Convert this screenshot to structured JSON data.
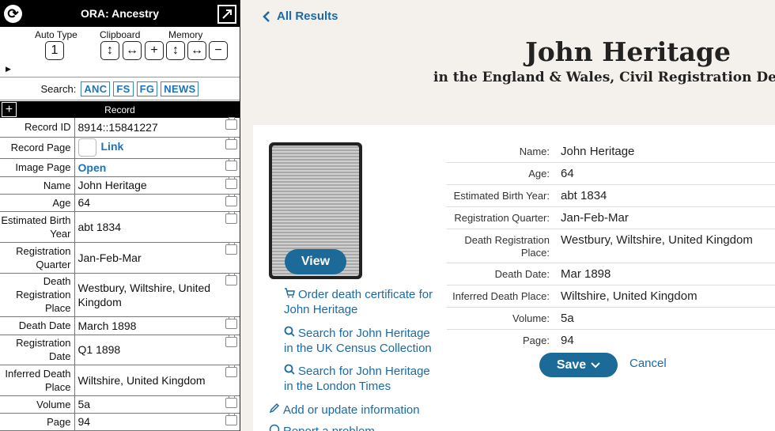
{
  "ora": {
    "title": "ORA: Ancestry",
    "controls": {
      "auto_type_label": "Auto Type",
      "auto_type_value": "1",
      "clipboard_label": "Clipboard",
      "memory_label": "Memory"
    },
    "search": {
      "label": "Search:",
      "sources": [
        "ANC",
        "FS",
        "FG",
        "NEWS"
      ]
    },
    "record_header": "Record",
    "fields": [
      {
        "key": "Record ID",
        "value": "8914::15841227"
      },
      {
        "key": "Record Page",
        "value": "Link"
      },
      {
        "key": "Image Page",
        "value": "Open"
      },
      {
        "key": "Name",
        "value": "John Heritage"
      },
      {
        "key": "Age",
        "value": "64"
      },
      {
        "key": "Estimated Birth Year",
        "value": "abt 1834"
      },
      {
        "key": "Registration Quarter",
        "value": "Jan-Feb-Mar"
      },
      {
        "key": "Death Registration Place",
        "value": "Westbury, Wiltshire, United Kingdom"
      },
      {
        "key": "Death Date",
        "value": "March 1898"
      },
      {
        "key": "Registration Date",
        "value": "Q1 1898"
      },
      {
        "key": "Inferred Death Place",
        "value": "Wiltshire, United Kingdom"
      },
      {
        "key": "Volume",
        "value": "5a"
      },
      {
        "key": "Page",
        "value": "94"
      }
    ]
  },
  "main": {
    "back_label": "All Results",
    "person_name": "John Heritage",
    "collection": "in the England & Wales, Civil Registration Death",
    "view_label": "View",
    "actions": {
      "order": "Order death certificate for John Heritage",
      "census": "Search for John Heritage in the UK Census Collection",
      "times": "Search for John Heritage in the London Times",
      "update": "Add or update information",
      "report": "Report a problem"
    },
    "facts": [
      {
        "label": "Name:",
        "value": "John Heritage"
      },
      {
        "label": "Age:",
        "value": "64"
      },
      {
        "label": "Estimated Birth Year:",
        "value": "abt 1834"
      },
      {
        "label": "Registration Quarter:",
        "value": "Jan-Feb-Mar"
      },
      {
        "label": "Death Registration Place:",
        "value": "Westbury, Wiltshire, United Kingdom"
      },
      {
        "label": "Death Date:",
        "value": "Mar 1898"
      },
      {
        "label": "Inferred Death Place:",
        "value": "Wiltshire, United Kingdom"
      },
      {
        "label": "Volume:",
        "value": "5a"
      },
      {
        "label": "Page:",
        "value": "94"
      }
    ],
    "save_label": "Save",
    "cancel_label": "Cancel"
  }
}
